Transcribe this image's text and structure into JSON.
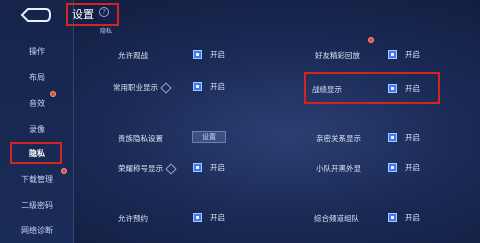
{
  "sidebar": {
    "items": [
      {
        "label": "操作"
      },
      {
        "label": "布局"
      },
      {
        "label": "音效"
      },
      {
        "label": "录像"
      },
      {
        "label": "隐私"
      },
      {
        "label": "下载管理"
      },
      {
        "label": "二级密码"
      },
      {
        "label": "网络诊断"
      }
    ]
  },
  "header": {
    "title": "设置",
    "section": "隐私"
  },
  "rows": [
    {
      "label": "允许观战",
      "value": "开启"
    },
    {
      "label": "好友精彩回放",
      "value": "开启"
    },
    {
      "label": "常用职业显示",
      "value": "开启"
    },
    {
      "label": "战绩显示",
      "value": "开启"
    },
    {
      "label": "贵族隐私设置",
      "button": "设置"
    },
    {
      "label": "亲密关系显示",
      "value": "开启"
    },
    {
      "label": "荣耀称号显示",
      "value": "开启"
    },
    {
      "label": "小队开黑外显",
      "value": "开启"
    },
    {
      "label": "允许预约",
      "value": "开启"
    },
    {
      "label": "综合频道组队",
      "value": "开启"
    }
  ],
  "colors": {
    "highlight_box": "#d42323",
    "checkbox": "#3d7cf0",
    "background": "#1a2a55"
  }
}
